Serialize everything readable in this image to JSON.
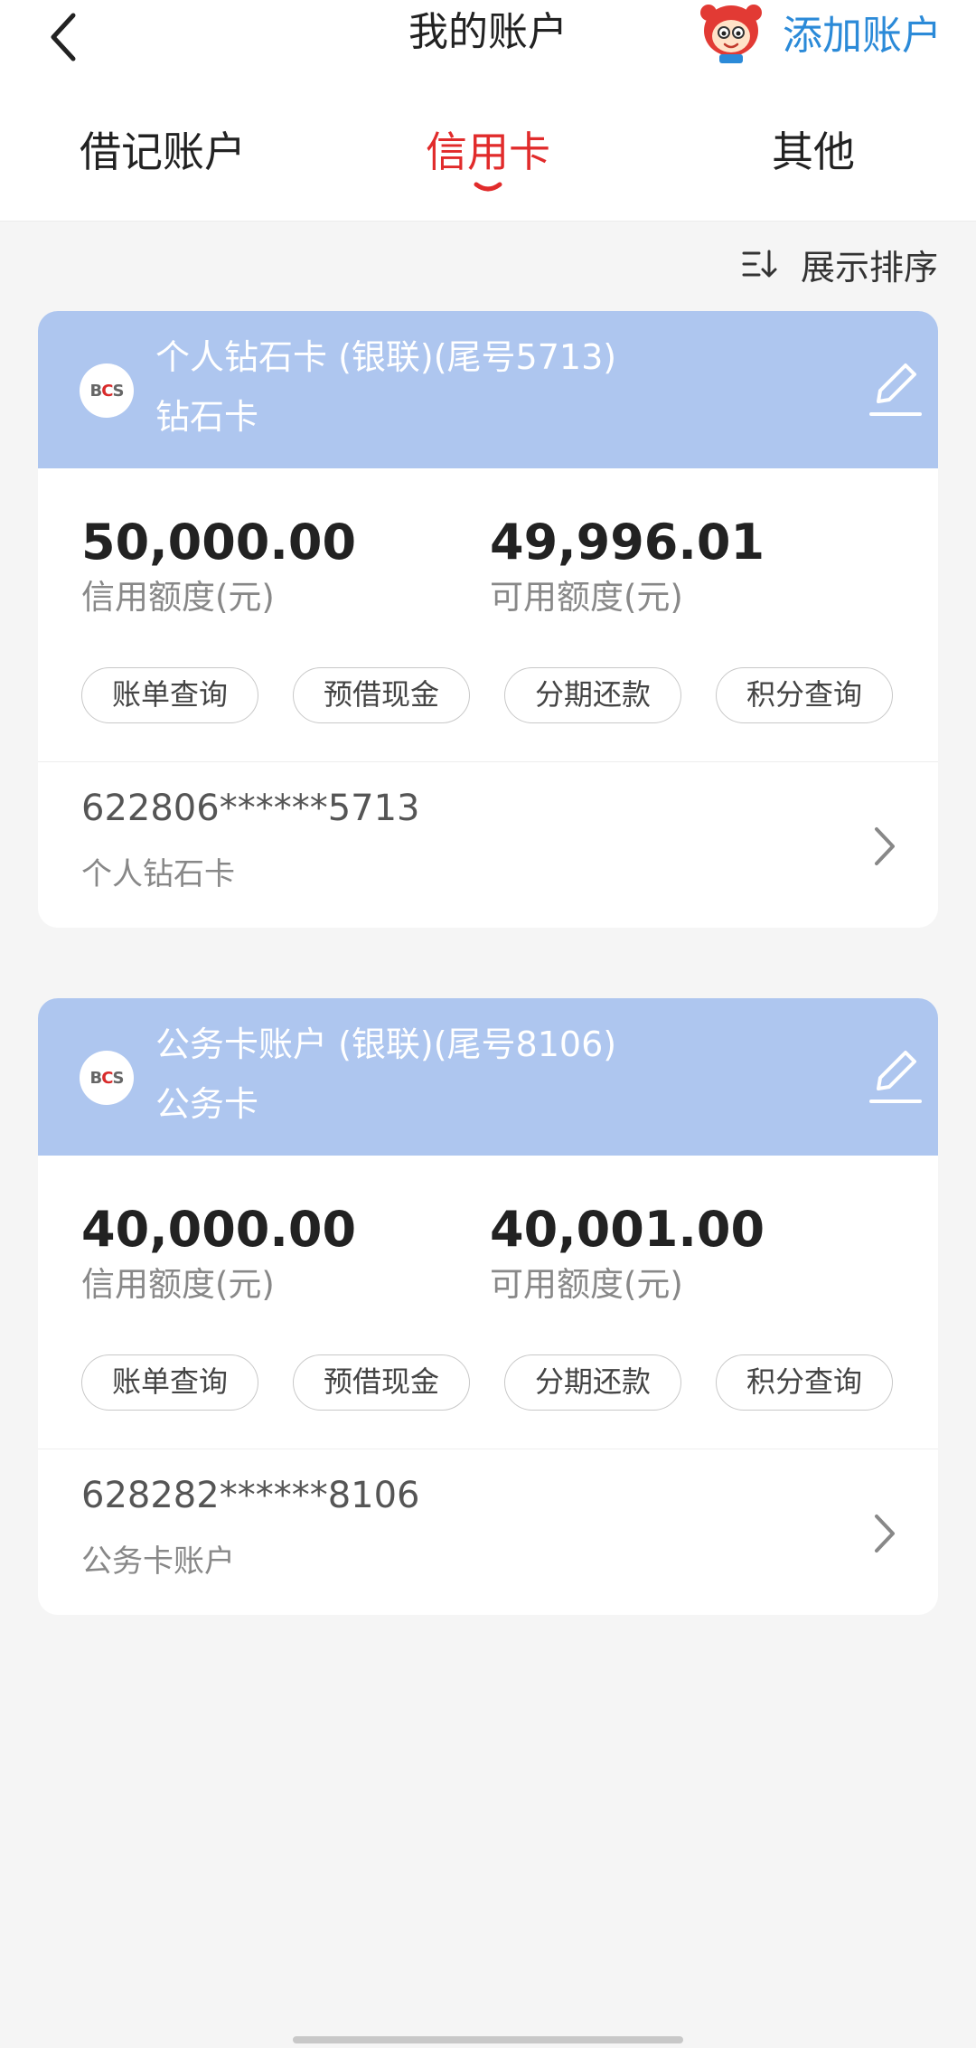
{
  "header": {
    "title": "我的账户",
    "add_account_label": "添加账户"
  },
  "tabs": [
    {
      "label": "借记账户",
      "active": false
    },
    {
      "label": "信用卡",
      "active": true
    },
    {
      "label": "其他",
      "active": false
    }
  ],
  "sort": {
    "label": "展示排序"
  },
  "cards": [
    {
      "name": "个人钻石卡 (银联)(尾号5713)",
      "type": "钻石卡",
      "credit_limit": "50,000.00",
      "credit_limit_label": "信用额度(元)",
      "available_limit": "49,996.01",
      "available_limit_label": "可用额度(元)",
      "actions": [
        "账单查询",
        "预借现金",
        "分期还款",
        "积分查询"
      ],
      "card_number": "622806******5713",
      "card_subtitle": "个人钻石卡"
    },
    {
      "name": "公务卡账户 (银联)(尾号8106)",
      "type": "公务卡",
      "credit_limit": "40,000.00",
      "credit_limit_label": "信用额度(元)",
      "available_limit": "40,001.00",
      "available_limit_label": "可用额度(元)",
      "actions": [
        "账单查询",
        "预借现金",
        "分期还款",
        "积分查询"
      ],
      "card_number": "628282******8106",
      "card_subtitle": "公务卡账户"
    }
  ],
  "colors": {
    "accent": "#e12b2b",
    "link": "#2b8ad8",
    "card_header": "#aec6ef"
  },
  "icons": {
    "back": "chevron-left-icon",
    "sort": "sort-icon",
    "edit": "pencil-icon",
    "row": "chevron-right-icon",
    "mascot": "mascot-icon",
    "bank_logo": "bcs-logo-icon"
  }
}
